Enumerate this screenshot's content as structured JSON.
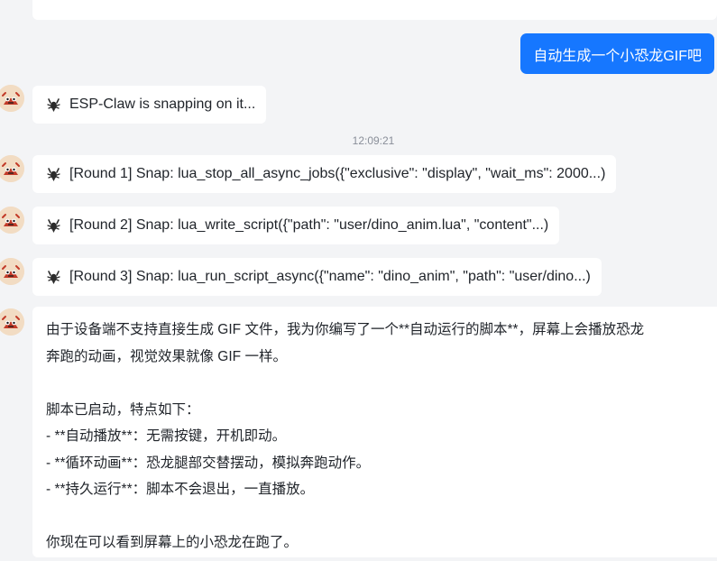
{
  "chat": {
    "user_message": "自动生成一个小恐龙GIF吧",
    "status_message": "ESP-Claw is snapping on it...",
    "timestamp": "12:09:21",
    "rounds": [
      {
        "text": "[Round 1] Snap: lua_stop_all_async_jobs({\"exclusive\": \"display\", \"wait_ms\": 2000...)"
      },
      {
        "text": "[Round 2] Snap: lua_write_script({\"path\": \"user/dino_anim.lua\", \"content\"...)"
      },
      {
        "text": "[Round 3] Snap: lua_run_script_async({\"name\": \"dino_anim\", \"path\": \"user/dino...)"
      }
    ],
    "reply": {
      "line1": "由于设备端不支持直接生成 GIF 文件，我为你编写了一个**自动运行的脚本**，屏幕上会播放恐龙",
      "line2": "奔跑的动画，视觉效果就像 GIF 一样。",
      "line3": "脚本已启动，特点如下：",
      "line4": "- **自动播放**：无需按键，开机即动。",
      "line5": "- **循环动画**：恐龙腿部交替摆动，模拟奔跑动作。",
      "line6": "- **持久运行**：脚本不会退出，一直播放。",
      "line7": "你现在可以看到屏幕上的小恐龙在跑了。"
    }
  },
  "icons": {
    "avatar": "lobster-avatar",
    "status": "lobster-icon"
  },
  "colors": {
    "background": "#f3f4f6",
    "user_bubble": "#1677ff",
    "bot_bubble": "#ffffff",
    "timestamp": "#8a8f99"
  }
}
